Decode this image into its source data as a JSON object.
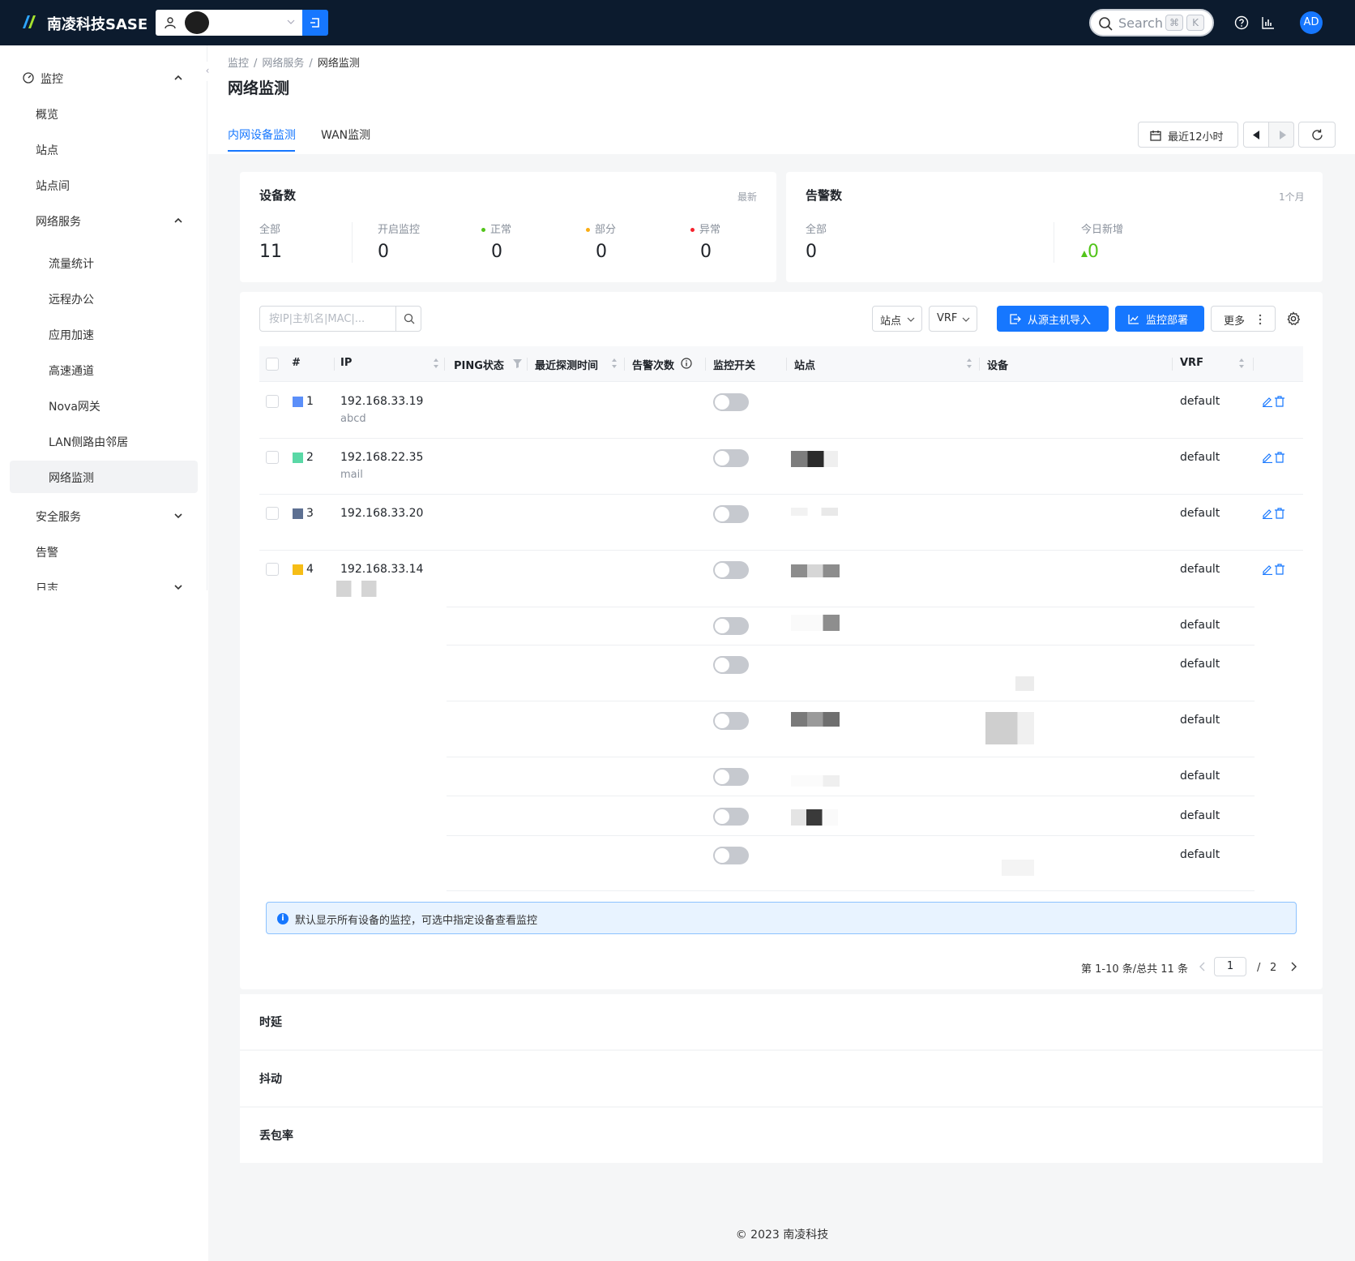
{
  "header": {
    "brand": "南凌科技SASE",
    "search_placeholder": "Search",
    "search_kbd": [
      "⌘",
      "K"
    ],
    "avatar_initials": "AD"
  },
  "sidebar": {
    "items": [
      {
        "label": "监控",
        "level": 0,
        "expanded": true
      },
      {
        "label": "概览",
        "level": 1
      },
      {
        "label": "站点",
        "level": 1
      },
      {
        "label": "站点间",
        "level": 1
      },
      {
        "label": "网络服务",
        "level": 1,
        "expanded": true
      },
      {
        "label": "流量统计",
        "level": 2
      },
      {
        "label": "远程办公",
        "level": 2
      },
      {
        "label": "应用加速",
        "level": 2
      },
      {
        "label": "高速通道",
        "level": 2
      },
      {
        "label": "Nova网关",
        "level": 2
      },
      {
        "label": "LAN侧路由邻居",
        "level": 2
      },
      {
        "label": "网络监测",
        "level": 2,
        "active": true
      },
      {
        "label": "安全服务",
        "level": 1,
        "expanded": false
      },
      {
        "label": "告警",
        "level": 1
      },
      {
        "label": "日志",
        "level": 1,
        "expanded": false
      }
    ]
  },
  "breadcrumb": [
    "监控",
    "网络服务",
    "网络监测"
  ],
  "page_title": "网络监测",
  "tabs": [
    {
      "label": "内网设备监测",
      "active": true
    },
    {
      "label": "WAN监测",
      "active": false
    }
  ],
  "time_range": "最近12小时",
  "device_card": {
    "title": "设备数",
    "note": "最新",
    "stats": [
      {
        "label": "全部",
        "value": "11"
      },
      {
        "label": "开启监控",
        "value": "0"
      },
      {
        "label": "正常",
        "value": "0",
        "dot": "#52c41a"
      },
      {
        "label": "部分",
        "value": "0",
        "dot": "#faad14"
      },
      {
        "label": "异常",
        "value": "0",
        "dot": "#f5222d"
      }
    ]
  },
  "alert_card": {
    "title": "告警数",
    "note": "1个月",
    "stats": [
      {
        "label": "全部",
        "value": "0"
      },
      {
        "label": "今日新增",
        "value": "0"
      }
    ]
  },
  "toolbar": {
    "search_placeholder": "按IP|主机名|MAC|...",
    "site_select": "站点",
    "vrf_select": "VRF",
    "import_label": "从源主机导入",
    "deploy_label": "监控部署",
    "more_label": "更多"
  },
  "table": {
    "columns": [
      "#",
      "IP",
      "PING状态",
      "最近探测时间",
      "告警次数",
      "监控开关",
      "站点",
      "设备",
      "VRF"
    ],
    "rows": [
      {
        "index": "1",
        "color": "#5b8ff9",
        "ip": "192.168.33.19",
        "host": "abcd",
        "monitor": false,
        "vrf": "default"
      },
      {
        "index": "2",
        "color": "#5ad8a6",
        "ip": "192.168.22.35",
        "host": "mail",
        "monitor": false,
        "vrf": "default"
      },
      {
        "index": "3",
        "color": "#5d7092",
        "ip": "192.168.33.20",
        "host": "",
        "monitor": false,
        "vrf": "default"
      },
      {
        "index": "4",
        "color": "#f6bd16",
        "ip": "192.168.33.14",
        "host": "",
        "monitor": false,
        "vrf": "default"
      },
      {
        "index": "",
        "ip": "",
        "host": "",
        "monitor": false,
        "vrf": "default"
      },
      {
        "index": "",
        "ip": "",
        "host": "",
        "monitor": false,
        "vrf": "default"
      },
      {
        "index": "",
        "ip": "",
        "host": "",
        "monitor": false,
        "vrf": "default"
      },
      {
        "index": "",
        "ip": "",
        "host": "",
        "monitor": false,
        "vrf": "default"
      },
      {
        "index": "",
        "ip": "",
        "host": "",
        "monitor": false,
        "vrf": "default"
      },
      {
        "index": "",
        "ip": "",
        "host": "",
        "monitor": false,
        "vrf": "default"
      }
    ]
  },
  "info_text": "默认显示所有设备的监控，可选中指定设备查看监控",
  "pagination": {
    "summary": "第 1-10 条/总共 11 条",
    "current": "1",
    "total_pages": "2",
    "separator": "/"
  },
  "metrics": [
    "时延",
    "抖动",
    "丢包率"
  ],
  "footer": "© 2023 南凌科技",
  "colors": {
    "accent": "#1677ff",
    "topbar": "#0c1b2e",
    "up_arrow": "#52c41a"
  }
}
